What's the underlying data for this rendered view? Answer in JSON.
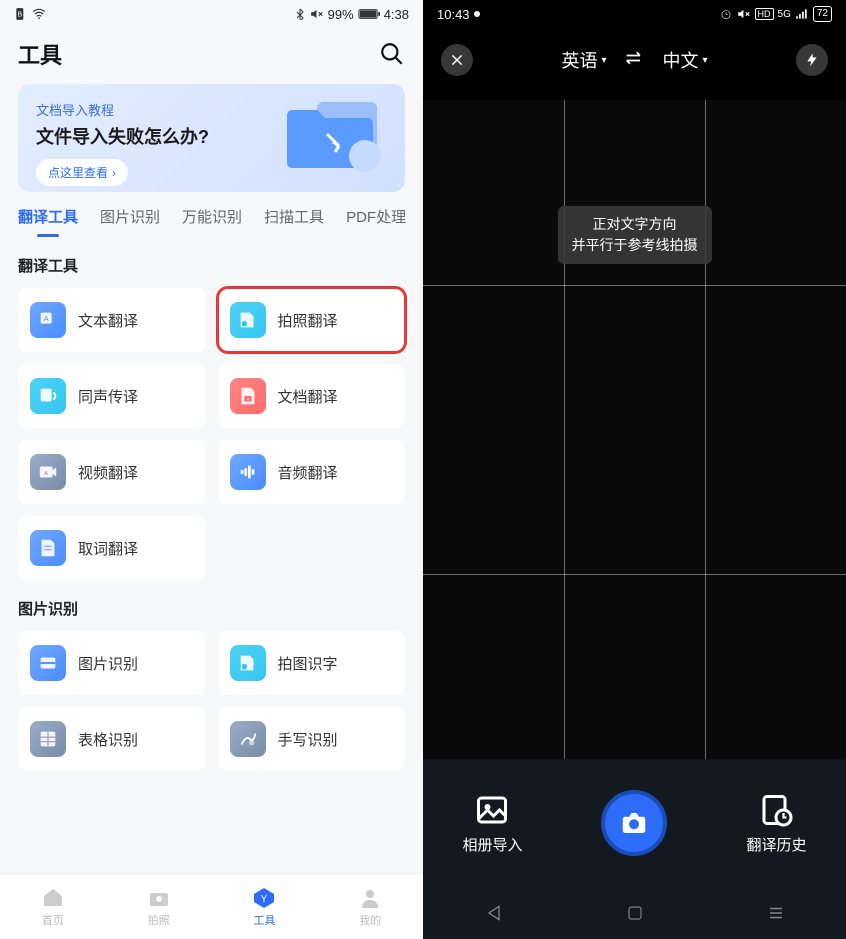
{
  "left": {
    "status": {
      "battery_pct": "99%",
      "time": "4:38"
    },
    "header": {
      "title": "工具"
    },
    "banner": {
      "subtitle": "文档导入教程",
      "title": "文件导入失败怎么办?",
      "button": "点这里查看"
    },
    "tabs": [
      "翻译工具",
      "图片识别",
      "万能识别",
      "扫描工具",
      "PDF处理"
    ],
    "sections": [
      {
        "title": "翻译工具",
        "items": [
          {
            "label": "文本翻译",
            "icon": "text-translate-icon",
            "color": "#4a8cff"
          },
          {
            "label": "拍照翻译",
            "icon": "photo-translate-icon",
            "color": "#35c6f0",
            "highlighted": true
          },
          {
            "label": "同声传译",
            "icon": "live-interpret-icon",
            "color": "#35c6f0"
          },
          {
            "label": "文档翻译",
            "icon": "doc-translate-icon",
            "color": "#ff6b6b"
          },
          {
            "label": "视频翻译",
            "icon": "video-translate-icon",
            "color": "#7a8aa8"
          },
          {
            "label": "音频翻译",
            "icon": "audio-translate-icon",
            "color": "#4a8cff"
          },
          {
            "label": "取词翻译",
            "icon": "word-pick-icon",
            "color": "#4a8cff"
          }
        ]
      },
      {
        "title": "图片识别",
        "items": [
          {
            "label": "图片识别",
            "icon": "image-recog-icon",
            "color": "#4a8cff"
          },
          {
            "label": "拍图识字",
            "icon": "photo-text-icon",
            "color": "#35c6f0"
          },
          {
            "label": "表格识别",
            "icon": "table-recog-icon",
            "color": "#7a8aa8"
          },
          {
            "label": "手写识别",
            "icon": "handwrite-icon",
            "color": "#7a8aa8"
          }
        ]
      }
    ],
    "bottomNav": [
      {
        "label": "首页",
        "icon": "home-icon"
      },
      {
        "label": "拍照",
        "icon": "camera-icon"
      },
      {
        "label": "工具",
        "icon": "tools-icon",
        "active": true
      },
      {
        "label": "我的",
        "icon": "profile-icon"
      }
    ]
  },
  "right": {
    "status": {
      "time": "10:43",
      "battery": "72"
    },
    "langFrom": "英语",
    "langTo": "中文",
    "hint_line1": "正对文字方向",
    "hint_line2": "并平行于参考线拍摄",
    "actions": {
      "gallery": "相册导入",
      "history": "翻译历史"
    }
  }
}
